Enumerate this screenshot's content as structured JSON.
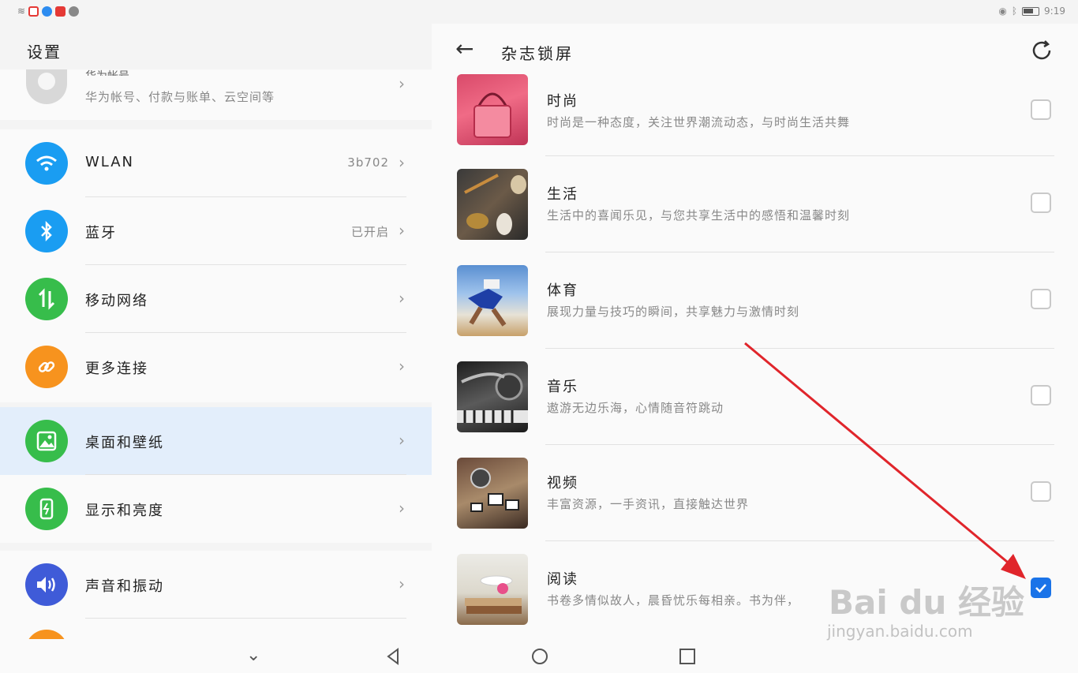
{
  "status": {
    "time": "9:19"
  },
  "left": {
    "title": "设置",
    "account": {
      "name": "华为帐号",
      "sub": "华为帐号、付款与账单、云空间等"
    },
    "items": [
      {
        "label": "WLAN",
        "value": "3b702",
        "icon": "wifi-icon",
        "color": "#1a9df2"
      },
      {
        "label": "蓝牙",
        "value": "已开启",
        "icon": "bluetooth-icon",
        "color": "#1a9df2"
      },
      {
        "label": "移动网络",
        "value": "",
        "icon": "mobile-data-icon",
        "color": "#37bd4b"
      },
      {
        "label": "更多连接",
        "value": "",
        "icon": "link-icon",
        "color": "#f7931e"
      },
      {
        "label": "桌面和壁纸",
        "value": "",
        "icon": "wallpaper-icon",
        "color": "#37bd4b"
      },
      {
        "label": "显示和亮度",
        "value": "",
        "icon": "display-icon",
        "color": "#37bd4b"
      },
      {
        "label": "声音和振动",
        "value": "",
        "icon": "sound-icon",
        "color": "#3f5bd8"
      }
    ]
  },
  "right": {
    "title": "杂志锁屏",
    "magazines": [
      {
        "name": "时尚",
        "desc": "时尚是一种态度，关注世界潮流动态，与时尚生活共舞",
        "checked": false
      },
      {
        "name": "生活",
        "desc": "生活中的喜闻乐见，与您共享生活中的感悟和温馨时刻",
        "checked": false
      },
      {
        "name": "体育",
        "desc": "展现力量与技巧的瞬间，共享魅力与激情时刻",
        "checked": false
      },
      {
        "name": "音乐",
        "desc": "遨游无边乐海，心情随音符跳动",
        "checked": false
      },
      {
        "name": "视频",
        "desc": "丰富资源，一手资讯，直接触达世界",
        "checked": false
      },
      {
        "name": "阅读",
        "desc": "书卷多情似故人，晨昏忧乐每相亲。书为伴，",
        "checked": true
      }
    ]
  },
  "watermark": {
    "main": "Bai du 经验",
    "sub": "jingyan.baidu.com"
  },
  "colors": {
    "accent": "#1a73e8",
    "arrow": "#e0252b",
    "selected_row": "#e3eefb"
  }
}
